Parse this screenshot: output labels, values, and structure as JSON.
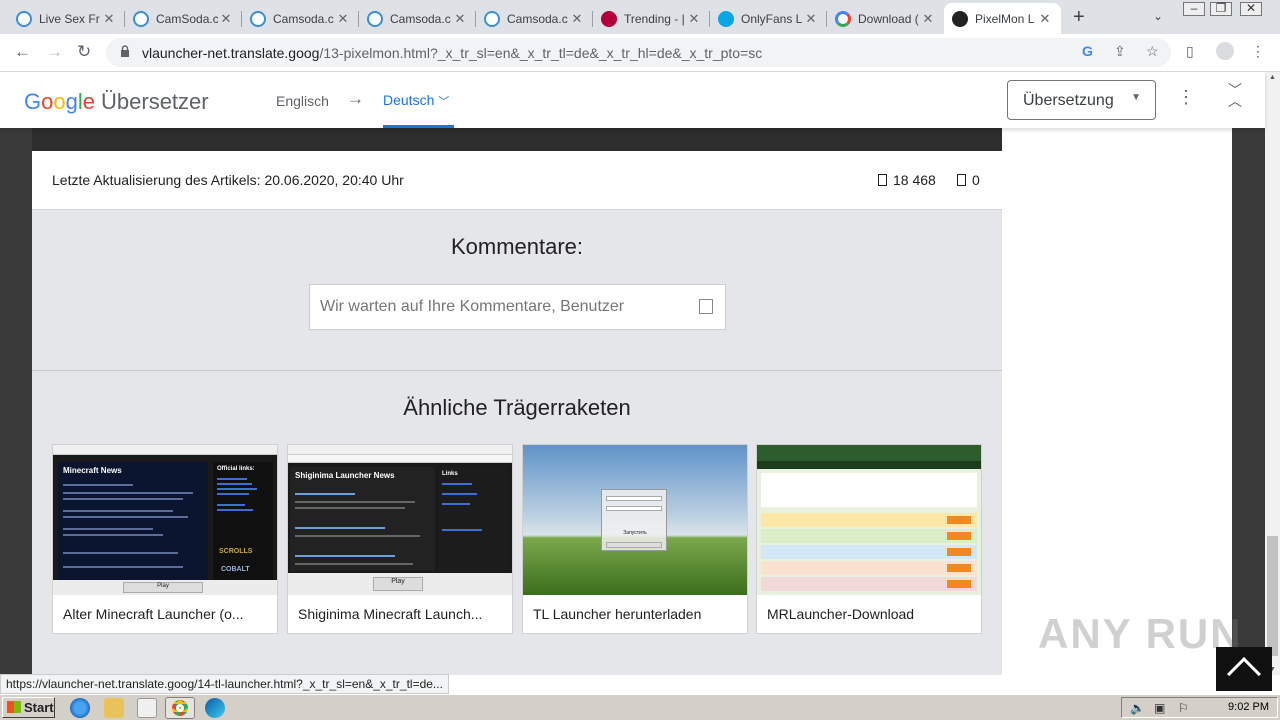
{
  "browser": {
    "tabs": [
      {
        "title": "Live Sex Fr",
        "favicon": "camsoda-icon"
      },
      {
        "title": "CamSoda.c",
        "favicon": "camsoda-icon"
      },
      {
        "title": "Camsoda.c",
        "favicon": "camsoda-icon"
      },
      {
        "title": "Camsoda.c",
        "favicon": "camsoda-icon"
      },
      {
        "title": "Camsoda.c",
        "favicon": "camsoda-icon"
      },
      {
        "title": "Trending - |",
        "favicon": "trending-icon"
      },
      {
        "title": "OnlyFans L",
        "favicon": "onlyfans-icon"
      },
      {
        "title": "Download (",
        "favicon": "google-icon"
      },
      {
        "title": "PixelMon L",
        "favicon": "pixelmon-icon",
        "active": true
      }
    ],
    "url_host": "vlauncher-net.translate.goog",
    "url_rest": "/13-pixelmon.html?_x_tr_sl=en&_x_tr_tl=de&_x_tr_hl=de&_x_tr_pto=sc",
    "status_url": "https://vlauncher-net.translate.goog/14-tl-launcher.html?_x_tr_sl=en&_x_tr_tl=de..."
  },
  "translate": {
    "logo_google": "Google",
    "logo_product": "Übersetzer",
    "source_lang": "Englisch",
    "arrow": "→",
    "target_lang": "Deutsch",
    "mode": "Übersetzung"
  },
  "article": {
    "updated": "Letzte Aktualisierung des Artikels: 20.06.2020, 20:40 Uhr",
    "views": "18 468",
    "comments_count": "0"
  },
  "comments": {
    "title": "Kommentare:",
    "placeholder": "Wir warten auf Ihre Kommentare, Benutzer"
  },
  "similar": {
    "title": "Ähnliche Trägerraketen",
    "cards": [
      {
        "caption": "Alter Minecraft Launcher (o...",
        "thumb": "minecraft-launcher"
      },
      {
        "caption": "Shiginima Minecraft Launch...",
        "thumb": "shiginima-launcher"
      },
      {
        "caption": "TL Launcher herunterladen",
        "thumb": "tl-launcher"
      },
      {
        "caption": "MRLauncher-Download",
        "thumb": "mrlauncher"
      }
    ],
    "thumb_text": {
      "mc_news": "Minecraft News",
      "mc_links": "Official links:",
      "mc_scrolls": "SCROLLS",
      "mc_cobalt": "COBALT",
      "mc_play": "Play",
      "shig_news": "Shiginima Launcher News",
      "shig_links": "Links",
      "shig_play": "Play",
      "tl_button": "Запустить"
    }
  },
  "watermark": "ANY RUN",
  "taskbar": {
    "start": "Start",
    "clock": "9:02 PM"
  },
  "colors": {
    "google_blue": "#4285f4",
    "google_red": "#ea4335",
    "google_yellow": "#fbbc05",
    "google_green": "#34a853",
    "accent": "#1a73e8"
  }
}
